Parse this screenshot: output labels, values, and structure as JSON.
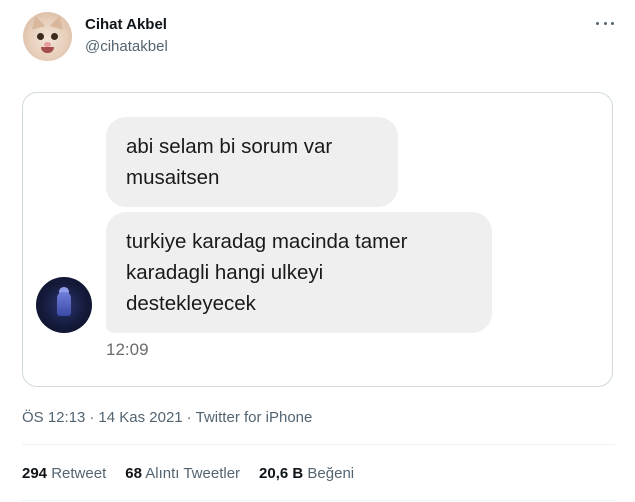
{
  "author": {
    "name": "Cihat Akbel",
    "handle": "@cihatakbel"
  },
  "media": {
    "messages": [
      "abi selam bi sorum var\nmusaitsen",
      "turkiye karadag macinda tamer\nkaradagli hangi ulkeyi\ndestekleyecek"
    ],
    "time": "12:09"
  },
  "meta": {
    "time": "ÖS 12:13",
    "date": "14 Kas 2021",
    "source": "Twitter for iPhone",
    "separator": "·"
  },
  "stats": {
    "retweets_count": "294",
    "retweets_label": "Retweet",
    "quotes_count": "68",
    "quotes_label": "Alıntı Tweetler",
    "likes_count": "20,6 B",
    "likes_label": "Beğeni"
  },
  "icons": {
    "more": "more-icon"
  }
}
